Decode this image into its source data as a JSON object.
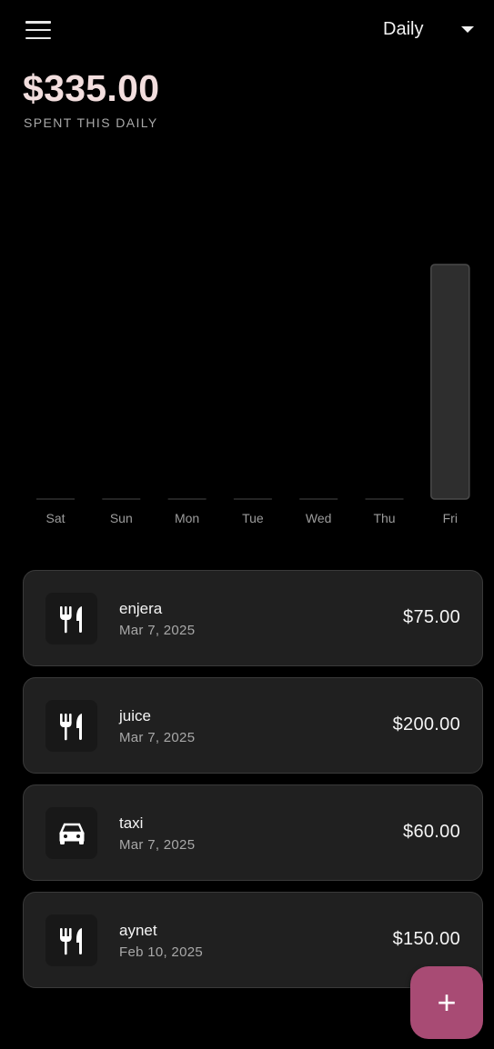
{
  "app_bar": {
    "menu_icon": "hamburger-menu-icon",
    "period": {
      "selected": "Daily",
      "icon": "dropdown-caret-icon"
    }
  },
  "summary": {
    "total": "$335.00",
    "caption": "SPENT THIS DAILY"
  },
  "chart_data": {
    "type": "bar",
    "categories": [
      "Sat",
      "Sun",
      "Mon",
      "Tue",
      "Wed",
      "Thu",
      "Fri"
    ],
    "values": [
      0,
      0,
      0,
      0,
      0,
      0,
      335
    ],
    "ylim": [
      0,
      335
    ],
    "grid": false,
    "colors": {
      "bar": "#2e2e2e",
      "bar_border": "#4a4a4a",
      "baseline": "#3a3a3a",
      "tick": "#9c9c9c"
    }
  },
  "expenses": [
    {
      "name": "enjera",
      "date": "Mar 7, 2025",
      "amount": "$75.00",
      "icon": "restaurant-icon"
    },
    {
      "name": "juice",
      "date": "Mar 7, 2025",
      "amount": "$200.00",
      "icon": "restaurant-icon"
    },
    {
      "name": "taxi",
      "date": "Mar 7, 2025",
      "amount": "$60.00",
      "icon": "car-icon"
    },
    {
      "name": "aynet",
      "date": "Feb 10, 2025",
      "amount": "$150.00",
      "icon": "restaurant-icon"
    }
  ],
  "fab": {
    "icon": "add-icon",
    "symbol": "+"
  },
  "colors": {
    "background": "#000000",
    "card": "#202020",
    "accent": "#a84b74",
    "total_text": "#f2dede"
  }
}
